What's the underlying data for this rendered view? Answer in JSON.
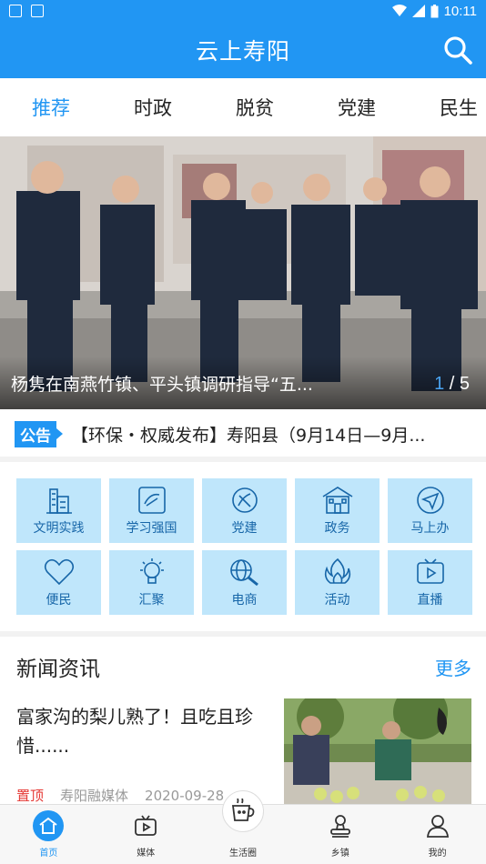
{
  "status_bar": {
    "time": "10:11"
  },
  "app_bar": {
    "title": "云上寿阳",
    "search_icon": "search-icon"
  },
  "tabs": [
    {
      "label": "推荐",
      "active": true
    },
    {
      "label": "时政"
    },
    {
      "label": "脱贫"
    },
    {
      "label": "党建"
    },
    {
      "label": "民生"
    }
  ],
  "banner": {
    "caption": "杨隽在南燕竹镇、平头镇调研指导“五...",
    "current": "1",
    "separator": " / ",
    "total": "5"
  },
  "notice": {
    "badge": "公告",
    "text": "【环保・权威发布】寿阳县（9月14日—9月..."
  },
  "services": [
    {
      "label": "文明实践",
      "icon": "building-icon"
    },
    {
      "label": "学习强国",
      "icon": "study-icon"
    },
    {
      "label": "党建",
      "icon": "party-emblem-icon"
    },
    {
      "label": "政务",
      "icon": "government-building-icon"
    },
    {
      "label": "马上办",
      "icon": "send-icon"
    },
    {
      "label": "便民",
      "icon": "heart-icon"
    },
    {
      "label": "汇聚",
      "icon": "lightbulb-icon"
    },
    {
      "label": "电商",
      "icon": "globe-search-icon"
    },
    {
      "label": "活动",
      "icon": "fire-icon"
    },
    {
      "label": "直播",
      "icon": "tv-play-icon"
    }
  ],
  "news": {
    "section_title": "新闻资讯",
    "more_label": "更多",
    "items": [
      {
        "title": "富家沟的梨儿熟了！且吃且珍惜......",
        "tag": "置顶",
        "source": "寿阳融媒体",
        "date": "2020-09-28"
      }
    ]
  },
  "bottom_nav": [
    {
      "label": "首页",
      "icon": "home-icon",
      "active": true
    },
    {
      "label": "媒体",
      "icon": "tv-icon"
    },
    {
      "label": "生活圈",
      "icon": "coffee-cup-icon"
    },
    {
      "label": "乡镇",
      "icon": "stamp-icon"
    },
    {
      "label": "我的",
      "icon": "user-icon"
    }
  ],
  "colors": {
    "primary": "#2196f3",
    "tile": "#bfe6fb",
    "tile_text": "#1766a8",
    "pin_tag": "#e53935"
  }
}
